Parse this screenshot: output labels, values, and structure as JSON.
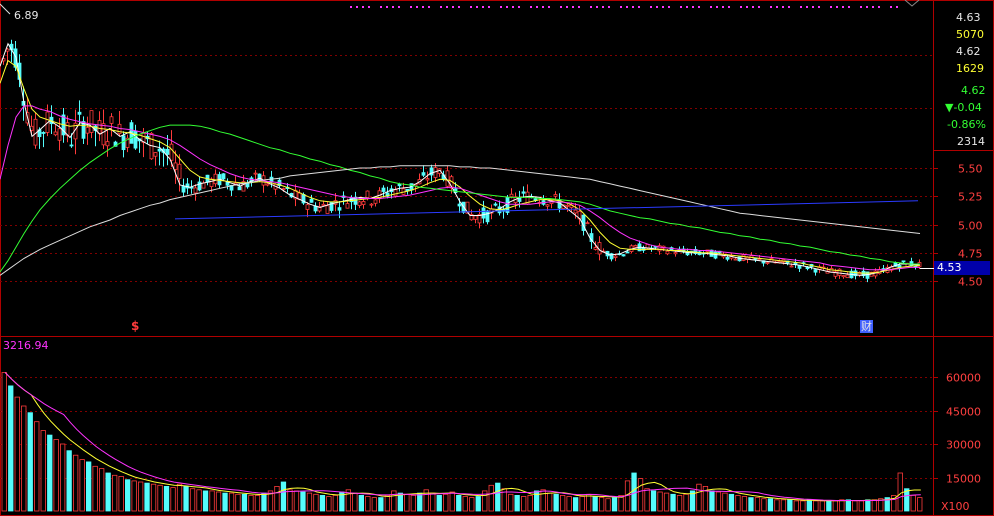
{
  "info_panel": {
    "value_1": "4.63",
    "value_2": "5070",
    "value_3": "4.62",
    "value_4": "1629",
    "value_5": "4.62",
    "change": "▼-0.04",
    "change_pct": "-0.86%",
    "value_6": "2314"
  },
  "price_high_label": "6.89",
  "volume_high_label": "3216.94",
  "last_price_tag": "4.53",
  "volume_unit": "X100",
  "event_markers": {
    "left": "$",
    "right": "财"
  },
  "colors": {
    "up": "#ff3b3b",
    "down": "#54fcfc",
    "ma5": "#ffffff",
    "ma10": "#ffff33",
    "ma20": "#ff33ff",
    "ma60": "#33ff33",
    "ma120": "#dddddd",
    "line_blue": "#2b3bff",
    "frame": "#b00000",
    "axis_text": "#ff4040",
    "dots": "#ff33ff",
    "last_tag_bg": "#0000aa"
  },
  "chart_data": [
    {
      "type": "line",
      "title": "",
      "y_ticks": [
        5.5,
        5.25,
        5.0,
        4.75,
        4.5
      ],
      "ylim": [
        4.05,
        7.05
      ],
      "high_marker": 6.89,
      "last_price": 4.53,
      "series": [
        {
          "x": [
            0,
            8,
            16,
            24,
            32,
            40,
            50,
            60,
            70,
            80,
            90,
            100,
            110,
            120,
            130,
            140,
            150,
            160,
            170,
            180,
            190,
            200,
            210,
            220,
            230,
            240,
            250,
            260,
            270,
            280,
            290,
            300,
            310,
            320,
            330,
            340,
            350,
            360,
            370,
            380,
            390,
            400,
            410,
            420,
            430,
            440,
            450,
            460,
            470,
            480,
            490,
            500,
            510,
            520,
            530,
            540,
            550,
            560,
            570,
            580,
            590,
            600,
            610,
            620,
            630,
            640,
            650,
            660,
            670,
            680,
            690,
            700,
            710,
            720,
            730,
            740,
            750,
            760,
            770,
            780,
            790,
            800,
            810,
            820,
            830,
            840,
            850,
            860,
            870,
            880,
            890,
            900,
            910,
            920
          ],
          "values": [
            6.4,
            6.6,
            6.48,
            6.08,
            5.78,
            5.84,
            5.92,
            5.86,
            5.77,
            5.9,
            5.88,
            5.8,
            5.85,
            5.78,
            5.82,
            5.75,
            5.7,
            5.68,
            5.58,
            5.35,
            5.33,
            5.36,
            5.38,
            5.4,
            5.37,
            5.34,
            5.38,
            5.41,
            5.36,
            5.32,
            5.26,
            5.22,
            5.18,
            5.15,
            5.18,
            5.2,
            5.22,
            5.24,
            5.23,
            5.26,
            5.3,
            5.32,
            5.33,
            5.38,
            5.45,
            5.48,
            5.36,
            5.2,
            5.08,
            5.08,
            5.1,
            5.14,
            5.2,
            5.24,
            5.25,
            5.24,
            5.21,
            5.19,
            5.12,
            5.05,
            4.88,
            4.77,
            4.73,
            4.74,
            4.78,
            4.8,
            4.79,
            4.78,
            4.77,
            4.76,
            4.75,
            4.75,
            4.74,
            4.73,
            4.72,
            4.7,
            4.69,
            4.68,
            4.67,
            4.66,
            4.65,
            4.64,
            4.62,
            4.6,
            4.58,
            4.57,
            4.56,
            4.55,
            4.56,
            4.58,
            4.62,
            4.65,
            4.65,
            4.64
          ]
        },
        {
          "values": [
            6.25,
            6.45,
            6.4,
            6.2,
            6.02,
            5.95,
            5.92,
            5.89,
            5.87,
            5.88,
            5.87,
            5.85,
            5.84,
            5.82,
            5.81,
            5.79,
            5.76,
            5.73,
            5.68,
            5.58,
            5.48,
            5.42,
            5.4,
            5.39,
            5.38,
            5.37,
            5.37,
            5.38,
            5.37,
            5.35,
            5.32,
            5.28,
            5.24,
            5.21,
            5.2,
            5.2,
            5.21,
            5.22,
            5.23,
            5.24,
            5.26,
            5.28,
            5.3,
            5.33,
            5.37,
            5.4,
            5.39,
            5.33,
            5.25,
            5.18,
            5.14,
            5.13,
            5.15,
            5.18,
            5.2,
            5.22,
            5.22,
            5.21,
            5.18,
            5.13,
            5.04,
            4.93,
            4.84,
            4.79,
            4.78,
            4.78,
            4.78,
            4.78,
            4.77,
            4.77,
            4.76,
            4.75,
            4.75,
            4.74,
            4.73,
            4.72,
            4.71,
            4.7,
            4.69,
            4.68,
            4.67,
            4.66,
            4.64,
            4.62,
            4.6,
            4.59,
            4.58,
            4.57,
            4.57,
            4.58,
            4.6,
            4.62,
            4.63,
            4.64
          ]
        },
        {
          "values": [
            5.4,
            5.7,
            5.95,
            6.05,
            6.05,
            6.02,
            6.0,
            5.96,
            5.93,
            5.91,
            5.89,
            5.88,
            5.87,
            5.85,
            5.84,
            5.82,
            5.8,
            5.78,
            5.75,
            5.7,
            5.64,
            5.58,
            5.53,
            5.49,
            5.45,
            5.42,
            5.4,
            5.39,
            5.38,
            5.37,
            5.35,
            5.33,
            5.31,
            5.29,
            5.27,
            5.25,
            5.24,
            5.23,
            5.23,
            5.23,
            5.24,
            5.25,
            5.26,
            5.28,
            5.3,
            5.32,
            5.33,
            5.32,
            5.29,
            5.26,
            5.23,
            5.2,
            5.18,
            5.18,
            5.18,
            5.19,
            5.2,
            5.2,
            5.19,
            5.17,
            5.12,
            5.06,
            4.99,
            4.93,
            4.88,
            4.85,
            4.82,
            4.8,
            4.79,
            4.78,
            4.78,
            4.77,
            4.77,
            4.76,
            4.75,
            4.74,
            4.73,
            4.72,
            4.71,
            4.7,
            4.69,
            4.68,
            4.67,
            4.66,
            4.64,
            4.63,
            4.62,
            4.61,
            4.6,
            4.6,
            4.6,
            4.61,
            4.62,
            4.62
          ]
        },
        {
          "values": [
            4.58,
            4.68,
            4.8,
            4.92,
            5.03,
            5.13,
            5.23,
            5.32,
            5.4,
            5.48,
            5.55,
            5.61,
            5.67,
            5.72,
            5.76,
            5.8,
            5.83,
            5.86,
            5.88,
            5.88,
            5.88,
            5.87,
            5.85,
            5.82,
            5.8,
            5.77,
            5.74,
            5.71,
            5.68,
            5.66,
            5.63,
            5.61,
            5.58,
            5.56,
            5.53,
            5.51,
            5.48,
            5.46,
            5.43,
            5.41,
            5.38,
            5.36,
            5.35,
            5.33,
            5.32,
            5.31,
            5.3,
            5.29,
            5.28,
            5.27,
            5.26,
            5.25,
            5.24,
            5.24,
            5.24,
            5.23,
            5.23,
            5.22,
            5.21,
            5.2,
            5.18,
            5.15,
            5.12,
            5.1,
            5.08,
            5.06,
            5.05,
            5.03,
            5.01,
            5.0,
            4.98,
            4.97,
            4.95,
            4.93,
            4.92,
            4.9,
            4.89,
            4.87,
            4.86,
            4.84,
            4.83,
            4.81,
            4.8,
            4.78,
            4.76,
            4.75,
            4.73,
            4.72,
            4.7,
            4.69,
            4.67,
            4.66,
            4.65,
            4.65
          ]
        },
        {
          "values": [
            4.55,
            4.6,
            4.65,
            4.7,
            4.74,
            4.78,
            4.82,
            4.86,
            4.9,
            4.94,
            4.98,
            5.01,
            5.04,
            5.08,
            5.11,
            5.14,
            5.17,
            5.19,
            5.22,
            5.24,
            5.26,
            5.28,
            5.3,
            5.32,
            5.34,
            5.36,
            5.37,
            5.39,
            5.4,
            5.41,
            5.43,
            5.44,
            5.45,
            5.46,
            5.47,
            5.48,
            5.49,
            5.5,
            5.5,
            5.51,
            5.51,
            5.52,
            5.52,
            5.52,
            5.52,
            5.52,
            5.52,
            5.51,
            5.51,
            5.5,
            5.5,
            5.49,
            5.48,
            5.47,
            5.46,
            5.45,
            5.44,
            5.43,
            5.42,
            5.41,
            5.4,
            5.38,
            5.36,
            5.34,
            5.32,
            5.3,
            5.28,
            5.26,
            5.24,
            5.22,
            5.2,
            5.18,
            5.16,
            5.14,
            5.12,
            5.1,
            5.09,
            5.08,
            5.07,
            5.06,
            5.05,
            5.04,
            5.03,
            5.02,
            5.01,
            5.0,
            4.99,
            4.98,
            4.97,
            4.96,
            4.95,
            4.94,
            4.93,
            4.92
          ]
        },
        {
          "x": [
            175,
            918
          ],
          "values": [
            5.05,
            5.21
          ]
        }
      ]
    },
    {
      "type": "bar",
      "title": "",
      "y_ticks": [
        60000,
        45000,
        30000,
        15000
      ],
      "ylim": [
        0,
        71000
      ],
      "high_marker": 3216.94,
      "unit": "X100",
      "values": [
        62000,
        56000,
        51000,
        47000,
        44000,
        40000,
        36000,
        34000,
        32000,
        30000,
        27000,
        25000,
        23000,
        22000,
        20000,
        19000,
        17000,
        16000,
        15500,
        14000,
        13500,
        13000,
        12500,
        12000,
        11500,
        11000,
        10500,
        12000,
        11000,
        10000,
        9500,
        9000,
        9000,
        8500,
        8000,
        8000,
        7500,
        7500,
        7000,
        7000,
        8000,
        9000,
        11000,
        13000,
        9500,
        9000,
        8500,
        8000,
        7500,
        7000,
        6500,
        7000,
        8500,
        9500,
        8000,
        7000,
        6500,
        6000,
        6000,
        7000,
        9000,
        8000,
        7500,
        7000,
        8000,
        9500,
        8000,
        7000,
        7500,
        8500,
        7000,
        6500,
        6000,
        6500,
        9000,
        11500,
        12500,
        10000,
        7500,
        7000,
        6500,
        7000,
        9000,
        9500,
        8000,
        7500,
        7000,
        6500,
        6000,
        6500,
        7500,
        6500,
        6000,
        5500,
        6000,
        7000,
        13500,
        17000,
        14500,
        10000,
        9000,
        8500,
        8000,
        7500,
        7000,
        7500,
        9000,
        12000,
        11000,
        9000,
        8500,
        8000,
        7500,
        7000,
        6500,
        6000,
        6000,
        5500,
        5500,
        5000,
        5000,
        5000,
        4500,
        4500,
        5000,
        4500,
        4500,
        4500,
        4500,
        5000,
        5000,
        4500,
        4500,
        5000,
        5000,
        5500,
        6000,
        7000,
        17000,
        10000,
        7000,
        6000
      ]
    }
  ]
}
